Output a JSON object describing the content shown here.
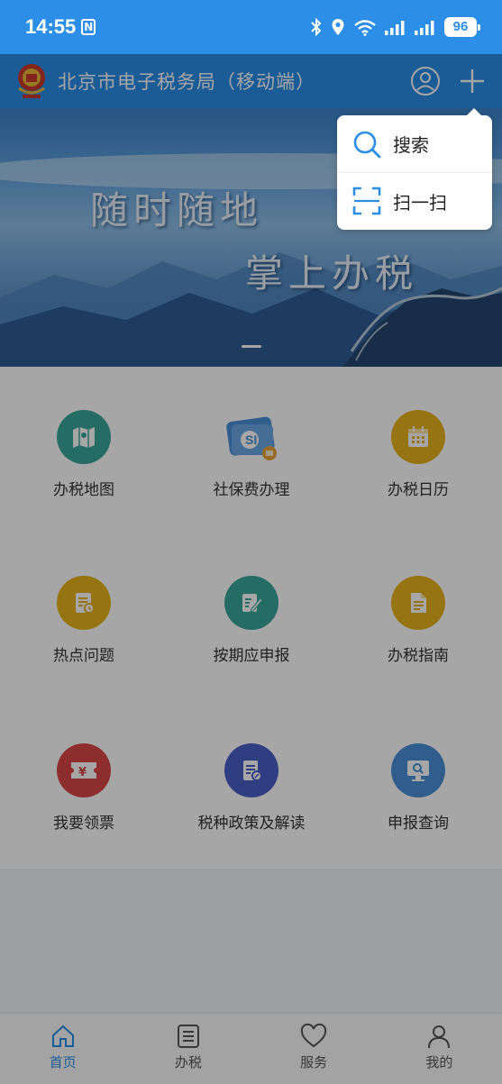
{
  "status_bar": {
    "time": "14:55",
    "n_badge": "N",
    "battery": "96"
  },
  "header": {
    "title": "北京市电子税务局（移动端）",
    "logo_icon": "tax-emblem-icon",
    "user_icon": "user-circle-icon",
    "add_icon": "plus-icon"
  },
  "banner": {
    "slogan_line1": "随时随地",
    "slogan_line2": "掌上办税"
  },
  "popup_menu": {
    "items": [
      {
        "label": "搜索",
        "icon": "search-icon"
      },
      {
        "label": "扫一扫",
        "icon": "scan-icon"
      }
    ]
  },
  "grid": {
    "items": [
      {
        "label": "办税地图",
        "icon": "map-icon",
        "color": "#3aa89a"
      },
      {
        "label": "社保费办理",
        "icon": "social-security-card-icon",
        "color": "#4a8fd6"
      },
      {
        "label": "办税日历",
        "icon": "calendar-icon",
        "color": "#e8b21c"
      },
      {
        "label": "热点问题",
        "icon": "hot-question-icon",
        "color": "#e8b21c"
      },
      {
        "label": "按期应申报",
        "icon": "declare-edit-icon",
        "color": "#3aa89a"
      },
      {
        "label": "办税指南",
        "icon": "guide-document-icon",
        "color": "#e8b21c"
      },
      {
        "label": "我要领票",
        "icon": "invoice-ticket-icon",
        "color": "#d94545"
      },
      {
        "label": "税种政策及解读",
        "icon": "policy-document-icon",
        "color": "#4b5fc6"
      },
      {
        "label": "申报查询",
        "icon": "query-monitor-icon",
        "color": "#4a8fd6"
      }
    ]
  },
  "bottom_nav": {
    "items": [
      {
        "label": "首页",
        "icon": "home-icon",
        "active": true
      },
      {
        "label": "办税",
        "icon": "list-icon",
        "active": false
      },
      {
        "label": "服务",
        "icon": "heart-icon",
        "active": false
      },
      {
        "label": "我的",
        "icon": "person-icon",
        "active": false
      }
    ]
  },
  "colors": {
    "primary": "#2c8ee6",
    "overlay": "rgba(0,0,0,0.35)"
  }
}
